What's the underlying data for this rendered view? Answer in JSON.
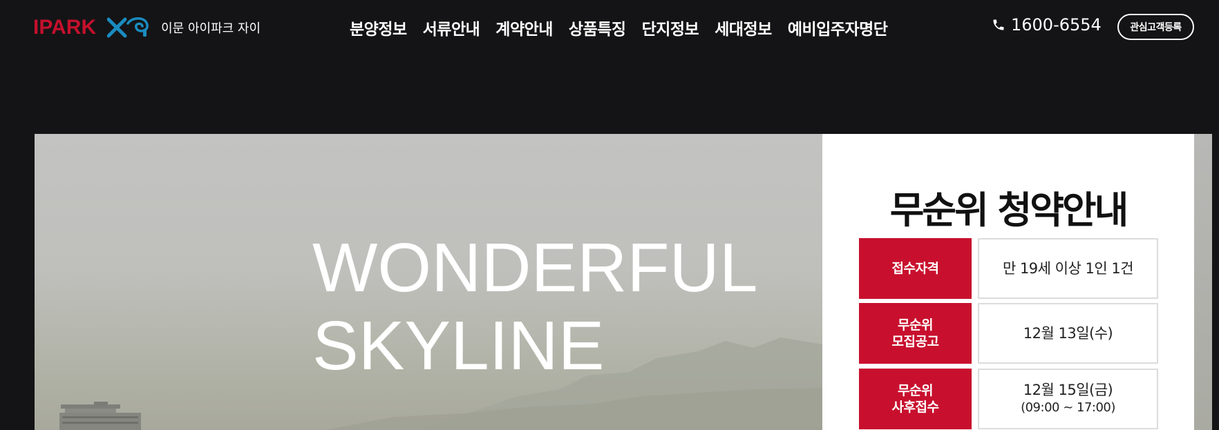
{
  "header": {
    "logo_text": "IPARK",
    "logo_xi_text": "Xi",
    "site_name": "이문 아이파크 자이",
    "nav": [
      "분양정보",
      "서류안내",
      "계약안내",
      "상품특징",
      "단지정보",
      "세대정보",
      "예비입주자명단"
    ],
    "phone": "1600-6554",
    "register_label": "관심고객등록"
  },
  "hero": {
    "title_line1": "WONDERFUL",
    "title_line2": "SKYLINE"
  },
  "panel": {
    "title": "무순위 청약안내",
    "rows": [
      {
        "label_line1": "접수자격",
        "label_line2": "",
        "value_line1": "만 19세 이상 1인 1건",
        "value_line2": ""
      },
      {
        "label_line1": "무순위",
        "label_line2": "모집공고",
        "value_line1": "12월 13일(수)",
        "value_line2": ""
      },
      {
        "label_line1": "무순위",
        "label_line2": "사후접수",
        "value_line1": "12월 15일(금)",
        "value_line2": "(09:00 ~ 17:00)"
      }
    ]
  },
  "colors": {
    "background": "#141416",
    "brand_red": "#c8102e",
    "xi_blue": "#1a8cc0"
  },
  "icons": {
    "phone": "phone-icon",
    "xi_logo": "xi-logo-icon"
  }
}
